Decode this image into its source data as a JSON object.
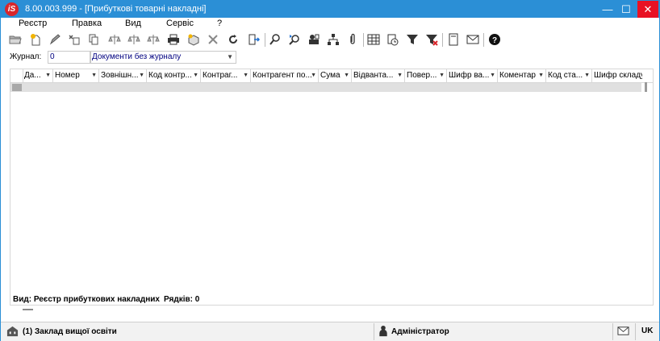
{
  "window": {
    "app_logo": "iS",
    "title": "8.00.003.999 - [Прибуткові товарні накладні]"
  },
  "menu": [
    "Реєстр",
    "Правка",
    "Вид",
    "Сервіс",
    "?"
  ],
  "toolbar": {
    "icons": [
      "open-folder-icon",
      "new-document-icon",
      "edit-icon",
      "copy-icon",
      "duplicate-icon",
      "balance-icon",
      "balance-left-icon",
      "balance-right-icon",
      "print-icon",
      "package-icon",
      "tools-icon",
      "refresh-icon",
      "export-icon",
      "search-icon",
      "find-next-icon",
      "org-chart-icon",
      "hierarchy-icon",
      "attachment-icon",
      "table-icon",
      "clock-settings-icon",
      "filter-icon",
      "clear-filter-icon",
      "document-icon",
      "mail-icon",
      "help-icon"
    ]
  },
  "journal": {
    "label": "Журнал:",
    "number": "0",
    "name": "Документи без журналу"
  },
  "grid": {
    "columns": [
      "Да...",
      "Номер",
      "Зовнішн...",
      "Код контр...",
      "Контраг...",
      "Контрагент по...",
      "Сума",
      "Відванта...",
      "Повер...",
      "Шифр ва...",
      "Коментар",
      "Код ста...",
      "Шифр складу"
    ]
  },
  "footer": {
    "view": "Вид: Реєстр прибуткових накладних",
    "rows": "Рядків: 0"
  },
  "status": {
    "org": "(1) Заклад вищої освіти",
    "user": "Адміністратор",
    "lang": "UK"
  },
  "colors": {
    "titlebar": "#2b8fd6",
    "close": "#e81123"
  }
}
